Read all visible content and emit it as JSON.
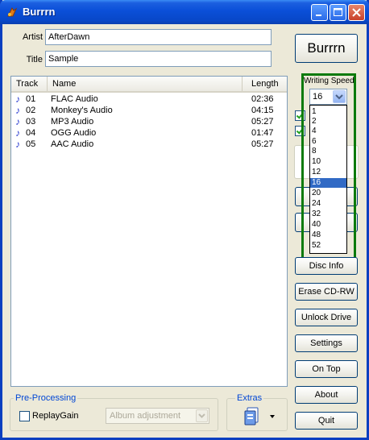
{
  "window": {
    "title": "Burrrn",
    "colors": {
      "titlebar": "#0a4fd8",
      "accent": "#0046d5",
      "highlight_border": "#0a7a0a"
    }
  },
  "fields": {
    "artist_label": "Artist",
    "artist_value": "AfterDawn",
    "title_label": "Title",
    "title_value": "Sample"
  },
  "tracklist": {
    "columns": [
      "Track",
      "Name",
      "Length"
    ],
    "rows": [
      {
        "track": "01",
        "name": "FLAC Audio",
        "length": "02:36"
      },
      {
        "track": "02",
        "name": "Monkey's Audio",
        "length": "04:15"
      },
      {
        "track": "03",
        "name": "MP3 Audio",
        "length": "05:27"
      },
      {
        "track": "04",
        "name": "OGG Audio",
        "length": "01:47"
      },
      {
        "track": "05",
        "name": "AAC Audio",
        "length": "05:27"
      }
    ]
  },
  "burn_button": "Burrrn",
  "writing_speed": {
    "label": "Writing Speed",
    "selected": "16",
    "options": [
      "1",
      "2",
      "4",
      "6",
      "8",
      "10",
      "12",
      "16",
      "20",
      "24",
      "32",
      "40",
      "48",
      "52"
    ]
  },
  "right_buttons": {
    "disc_info": "Disc Info",
    "erase": "Erase CD-RW",
    "unlock": "Unlock Drive",
    "settings": "Settings",
    "on_top": "On Top",
    "about": "About",
    "quit": "Quit"
  },
  "preprocessing": {
    "title": "Pre-Processing",
    "replaygain_label": "ReplayGain",
    "replaygain_checked": false,
    "mode_value": "Album adjustment"
  },
  "extras": {
    "title": "Extras"
  },
  "icons": [
    "app-icon",
    "minimize-icon",
    "maximize-icon",
    "close-icon",
    "music-note-icon",
    "dropdown-arrow-icon",
    "extras-icon"
  ]
}
